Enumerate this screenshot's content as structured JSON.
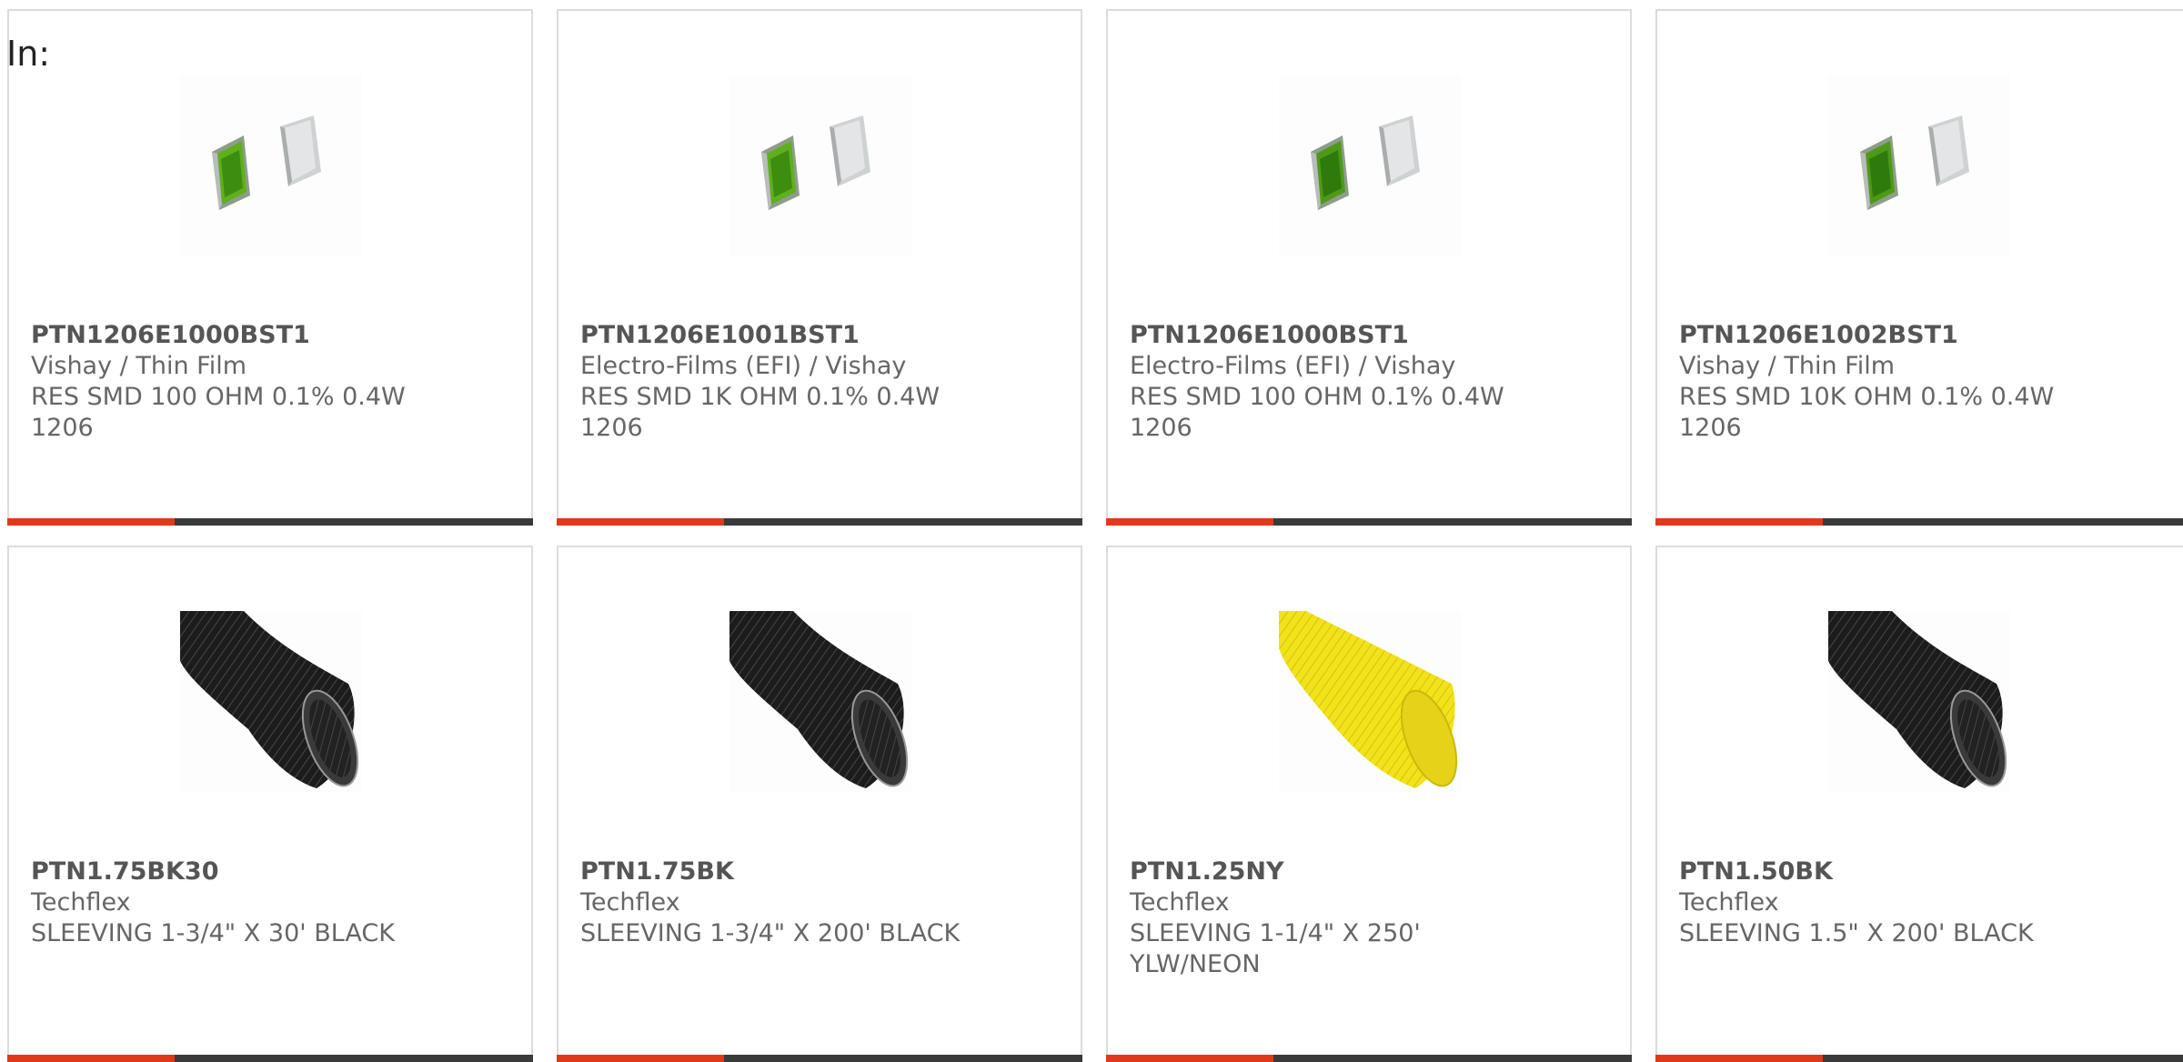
{
  "header": {
    "label": "In:"
  },
  "colors": {
    "accent": "#e0391a",
    "bar": "#3a3a3a",
    "border": "#dcdcdc",
    "text": "#666666"
  },
  "products": [
    {
      "part": "PTN1206E1000BST1",
      "mfr": "Vishay / Thin Film",
      "desc1": "RES SMD 100 OHM 0.1% 0.4W",
      "desc2": "1206",
      "image": "smd-resistor-image"
    },
    {
      "part": "PTN1206E1001BST1",
      "mfr": "Electro-Films (EFI) / Vishay",
      "desc1": "RES SMD 1K OHM 0.1% 0.4W",
      "desc2": "1206",
      "image": "smd-resistor-image"
    },
    {
      "part": "PTN1206E1000BST1",
      "mfr": "Electro-Films (EFI) / Vishay",
      "desc1": "RES SMD 100 OHM 0.1% 0.4W",
      "desc2": "1206",
      "image": "smd-resistor-image"
    },
    {
      "part": "PTN1206E1002BST1",
      "mfr": "Vishay / Thin Film",
      "desc1": "RES SMD 10K OHM 0.1% 0.4W",
      "desc2": "1206",
      "image": "smd-resistor-image"
    },
    {
      "part": "PTN1.75BK30",
      "mfr": "Techflex",
      "desc1": "SLEEVING 1-3/4\" X 30' BLACK",
      "desc2": "",
      "image": "black-sleeving-image"
    },
    {
      "part": "PTN1.75BK",
      "mfr": "Techflex",
      "desc1": "SLEEVING 1-3/4\" X 200' BLACK",
      "desc2": "",
      "image": "black-sleeving-image"
    },
    {
      "part": "PTN1.25NY",
      "mfr": "Techflex",
      "desc1": "SLEEVING 1-1/4\" X 250'",
      "desc2": "YLW/NEON",
      "image": "yellow-sleeving-image"
    },
    {
      "part": "PTN1.50BK",
      "mfr": "Techflex",
      "desc1": "SLEEVING 1.5\" X 200' BLACK",
      "desc2": "",
      "image": "black-sleeving-image"
    }
  ]
}
